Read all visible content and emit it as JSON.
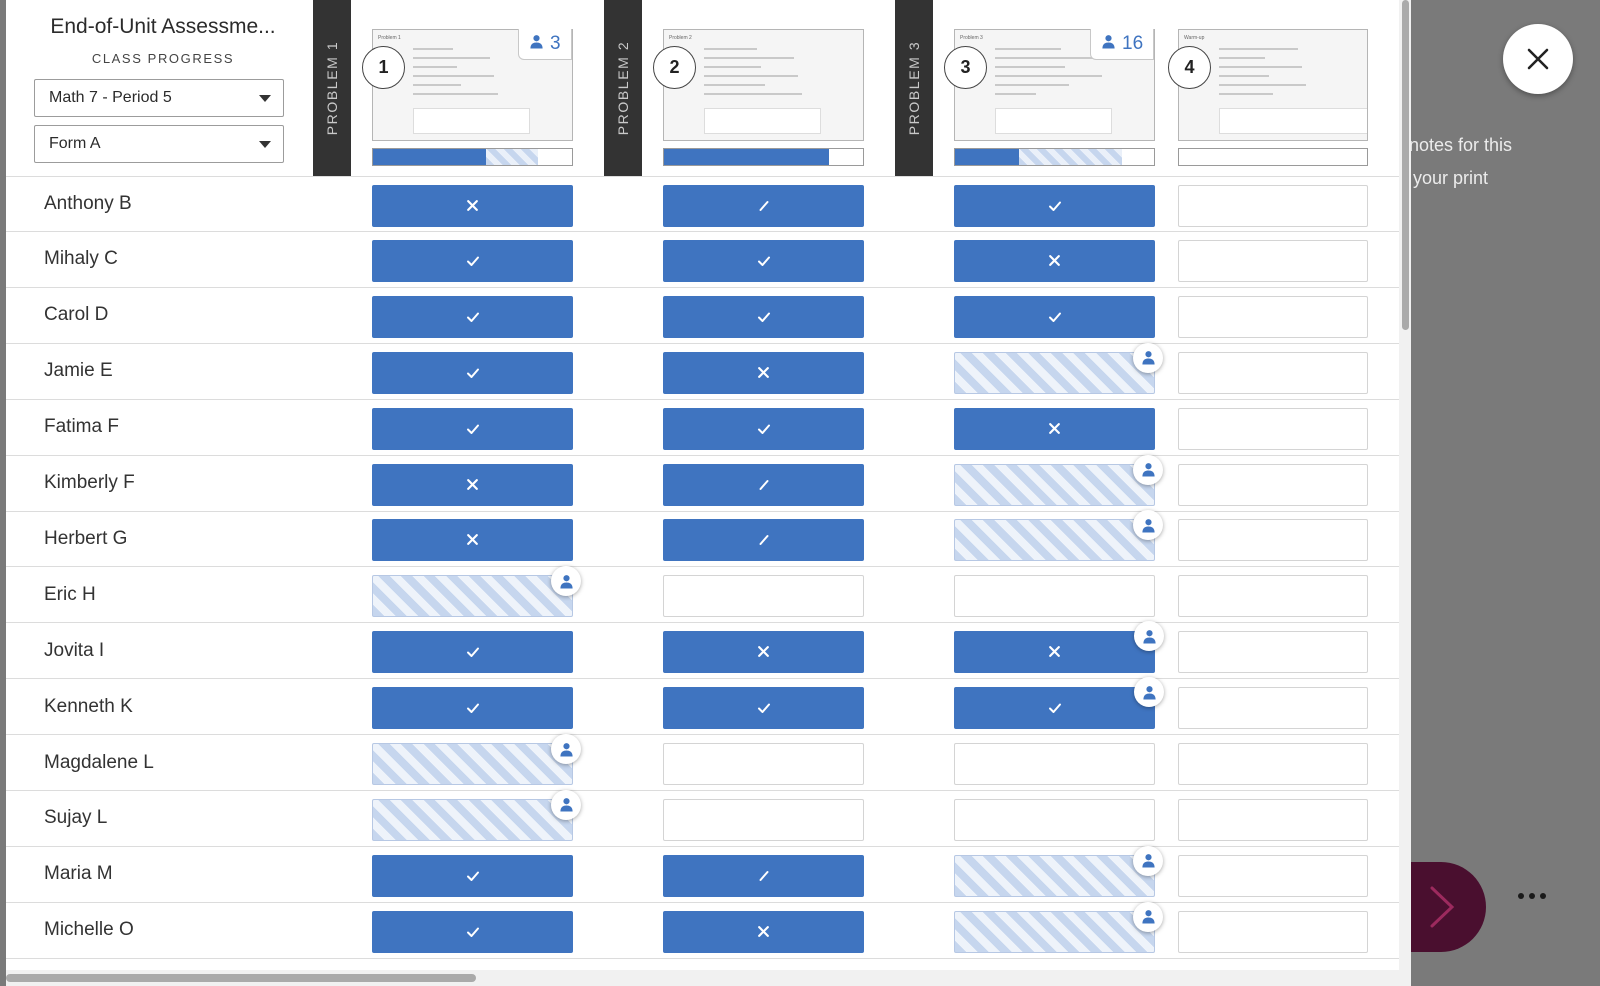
{
  "background": {
    "notes_line1": "r notes for this",
    "notes_line2": "o your print"
  },
  "header": {
    "title": "End-of-Unit Assessme...",
    "subtitle": "CLASS PROGRESS",
    "class_select": "Math 7 - Period 5",
    "form_select": "Form A"
  },
  "problems": [
    {
      "band_label": "PROBLEM 1",
      "number": "1",
      "count": "3",
      "thumb_title": "Problem 1",
      "progress_complete": 0.57,
      "progress_in_progress": 0.26
    },
    {
      "band_label": "PROBLEM 2",
      "number": "2",
      "count": "",
      "thumb_title": "Problem 2",
      "progress_complete": 0.83,
      "progress_in_progress": 0
    },
    {
      "band_label": "PROBLEM 3",
      "number": "3",
      "count": "16",
      "thumb_title": "Problem 3",
      "progress_complete": 0.32,
      "progress_in_progress": 0.52
    },
    {
      "band_label": "",
      "number": "4",
      "count": "",
      "thumb_title": "Warm-up",
      "progress_complete": 0,
      "progress_in_progress": 0
    }
  ],
  "students": [
    {
      "name": "Anthony B",
      "cells": [
        {
          "s": "complete",
          "m": "x"
        },
        {
          "s": "complete",
          "m": "slash"
        },
        {
          "s": "complete",
          "m": "check"
        },
        {
          "s": "empty"
        }
      ]
    },
    {
      "name": "Mihaly C",
      "cells": [
        {
          "s": "complete",
          "m": "check"
        },
        {
          "s": "complete",
          "m": "check"
        },
        {
          "s": "complete",
          "m": "x"
        },
        {
          "s": "empty"
        }
      ]
    },
    {
      "name": "Carol D",
      "cells": [
        {
          "s": "complete",
          "m": "check"
        },
        {
          "s": "complete",
          "m": "check"
        },
        {
          "s": "complete",
          "m": "check"
        },
        {
          "s": "empty"
        }
      ]
    },
    {
      "name": "Jamie E",
      "cells": [
        {
          "s": "complete",
          "m": "check"
        },
        {
          "s": "complete",
          "m": "x"
        },
        {
          "s": "partial",
          "p": true
        },
        {
          "s": "empty"
        }
      ]
    },
    {
      "name": "Fatima F",
      "cells": [
        {
          "s": "complete",
          "m": "check"
        },
        {
          "s": "complete",
          "m": "check"
        },
        {
          "s": "complete",
          "m": "x"
        },
        {
          "s": "empty"
        }
      ]
    },
    {
      "name": "Kimberly F",
      "cells": [
        {
          "s": "complete",
          "m": "x"
        },
        {
          "s": "complete",
          "m": "slash"
        },
        {
          "s": "partial",
          "p": true
        },
        {
          "s": "empty"
        }
      ]
    },
    {
      "name": "Herbert G",
      "cells": [
        {
          "s": "complete",
          "m": "x"
        },
        {
          "s": "complete",
          "m": "slash"
        },
        {
          "s": "partial",
          "p": true
        },
        {
          "s": "empty"
        }
      ]
    },
    {
      "name": "Eric H",
      "cells": [
        {
          "s": "partial",
          "p": true
        },
        {
          "s": "empty"
        },
        {
          "s": "empty"
        },
        {
          "s": "empty"
        }
      ]
    },
    {
      "name": "Jovita I",
      "cells": [
        {
          "s": "complete",
          "m": "check"
        },
        {
          "s": "complete",
          "m": "x"
        },
        {
          "s": "complete",
          "m": "x",
          "p": true
        },
        {
          "s": "empty"
        }
      ]
    },
    {
      "name": "Kenneth K",
      "cells": [
        {
          "s": "complete",
          "m": "check"
        },
        {
          "s": "complete",
          "m": "check"
        },
        {
          "s": "complete",
          "m": "check",
          "p": true
        },
        {
          "s": "empty"
        }
      ]
    },
    {
      "name": "Magdalene L",
      "cells": [
        {
          "s": "partial",
          "p": true
        },
        {
          "s": "empty"
        },
        {
          "s": "empty"
        },
        {
          "s": "empty"
        }
      ]
    },
    {
      "name": "Sujay L",
      "cells": [
        {
          "s": "partial",
          "p": true
        },
        {
          "s": "empty"
        },
        {
          "s": "empty"
        },
        {
          "s": "empty"
        }
      ]
    },
    {
      "name": "Maria M",
      "cells": [
        {
          "s": "complete",
          "m": "check"
        },
        {
          "s": "complete",
          "m": "slash"
        },
        {
          "s": "partial",
          "p": true
        },
        {
          "s": "empty"
        }
      ]
    },
    {
      "name": "Michelle O",
      "cells": [
        {
          "s": "complete",
          "m": "check"
        },
        {
          "s": "complete",
          "m": "x"
        },
        {
          "s": "partial",
          "p": true
        },
        {
          "s": "empty"
        }
      ]
    }
  ],
  "icons": {
    "close": "close-icon",
    "next": "chevron-right-icon",
    "more": "more-options-icon",
    "student": "student-icon",
    "caret": "chevron-down-icon"
  },
  "colors": {
    "accent": "#3f74c0",
    "next_button": "#4a0f2f",
    "problem_band": "#333333"
  }
}
